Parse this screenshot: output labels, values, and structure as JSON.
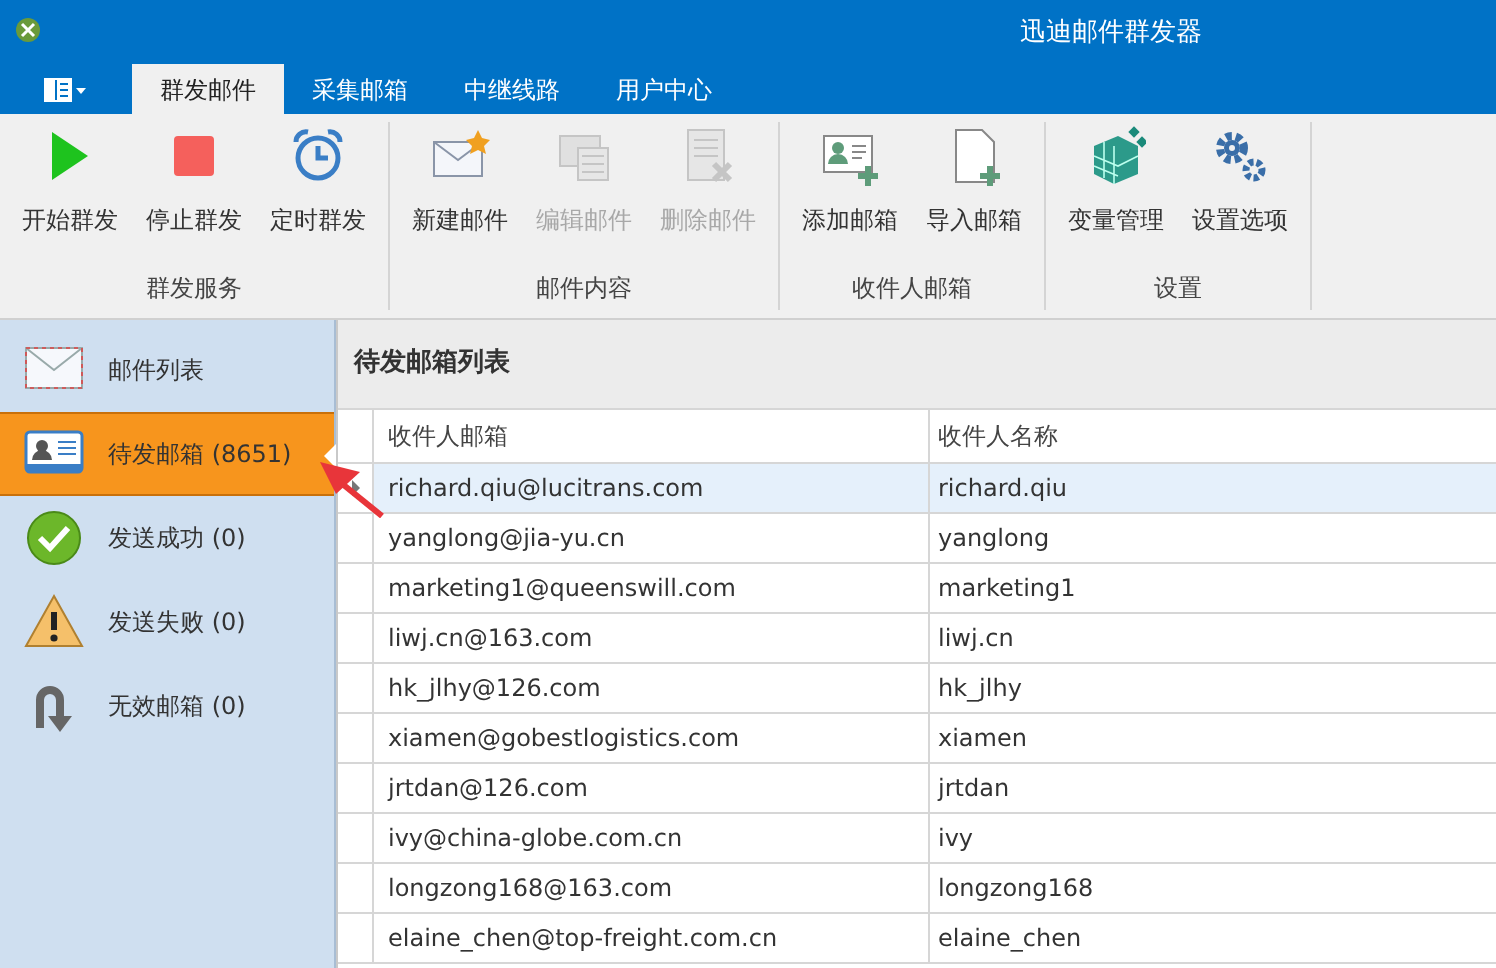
{
  "window": {
    "title": "迅迪邮件群发器"
  },
  "tabs": [
    {
      "label": "群发邮件",
      "selected": true
    },
    {
      "label": "采集邮箱",
      "selected": false
    },
    {
      "label": "中继线路",
      "selected": false
    },
    {
      "label": "用户中心",
      "selected": false
    }
  ],
  "ribbon_groups": [
    {
      "label": "群发服务",
      "buttons": [
        {
          "kind": "play",
          "label": "开始群发",
          "disabled": false
        },
        {
          "kind": "stop",
          "label": "停止群发",
          "disabled": false
        },
        {
          "kind": "clock",
          "label": "定时群发",
          "disabled": false
        }
      ]
    },
    {
      "label": "邮件内容",
      "buttons": [
        {
          "kind": "newmail",
          "label": "新建邮件",
          "disabled": false
        },
        {
          "kind": "editmail",
          "label": "编辑邮件",
          "disabled": true
        },
        {
          "kind": "deletemail",
          "label": "删除邮件",
          "disabled": true
        }
      ]
    },
    {
      "label": "收件人邮箱",
      "buttons": [
        {
          "kind": "addcard",
          "label": "添加邮箱",
          "disabled": false
        },
        {
          "kind": "import",
          "label": "导入邮箱",
          "disabled": false
        }
      ]
    },
    {
      "label": "设置",
      "buttons": [
        {
          "kind": "cubes",
          "label": "变量管理",
          "disabled": false
        },
        {
          "kind": "gears",
          "label": "设置选项",
          "disabled": false
        }
      ]
    }
  ],
  "sidebar": {
    "items": [
      {
        "kind": "envelope",
        "label": "邮件列表",
        "selected": false
      },
      {
        "kind": "card",
        "label": "待发邮箱 (8651)",
        "selected": true
      },
      {
        "kind": "check",
        "label": "发送成功 (0)",
        "selected": false
      },
      {
        "kind": "warning",
        "label": "发送失败 (0)",
        "selected": false
      },
      {
        "kind": "uturn",
        "label": "无效邮箱 (0)",
        "selected": false
      }
    ]
  },
  "panel": {
    "title": "待发邮箱列表"
  },
  "table": {
    "columns": [
      "收件人邮箱",
      "收件人名称"
    ],
    "rows": [
      {
        "cells": [
          "richard.qiu@lucitrans.com",
          "richard.qiu"
        ],
        "selected": true
      },
      {
        "cells": [
          "yanglong@jia-yu.cn",
          "yanglong"
        ],
        "selected": false
      },
      {
        "cells": [
          "marketing1@queenswill.com",
          "marketing1"
        ],
        "selected": false
      },
      {
        "cells": [
          "liwj.cn@163.com",
          "liwj.cn"
        ],
        "selected": false
      },
      {
        "cells": [
          "hk_jlhy@126.com",
          "hk_jlhy"
        ],
        "selected": false
      },
      {
        "cells": [
          "xiamen@gobestlogistics.com",
          "xiamen"
        ],
        "selected": false
      },
      {
        "cells": [
          "jrtdan@126.com",
          "jrtdan"
        ],
        "selected": false
      },
      {
        "cells": [
          "ivy@china-globe.com.cn",
          "ivy"
        ],
        "selected": false
      },
      {
        "cells": [
          "longzong168@163.com",
          "longzong168"
        ],
        "selected": false
      },
      {
        "cells": [
          "elaine_chen@top-freight.com.cn",
          "elaine_chen"
        ],
        "selected": false
      }
    ]
  }
}
